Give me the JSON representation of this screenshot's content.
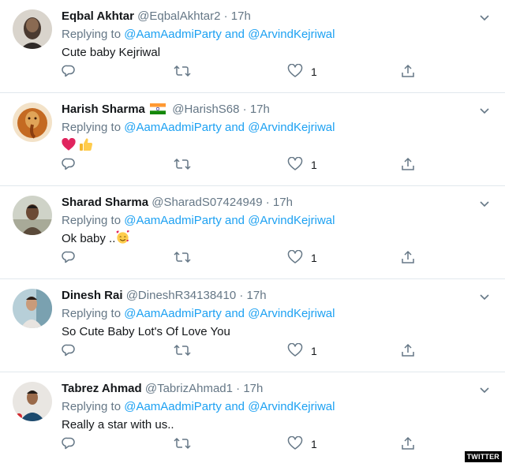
{
  "tweets": [
    {
      "name": "Eqbal Akhtar",
      "handle": "@EqbalAkhtar2",
      "dot": "·",
      "time": "17h",
      "replying_prefix": "Replying to",
      "mention1": "@AamAadmiParty",
      "and": "and",
      "mention2": "@ArvindKejriwal",
      "text": "Cute baby Kejriwal",
      "likes": "1"
    },
    {
      "name": "Harish Sharma",
      "handle": "@HarishS68",
      "dot": "·",
      "time": "17h",
      "replying_prefix": "Replying to",
      "mention1": "@AamAadmiParty",
      "and": "and",
      "mention2": "@ArvindKejriwal",
      "text": "",
      "likes": "1"
    },
    {
      "name": "Sharad Sharma",
      "handle": "@SharadS07424949",
      "dot": "·",
      "time": "17h",
      "replying_prefix": "Replying to",
      "mention1": "@AamAadmiParty",
      "and": "and",
      "mention2": "@ArvindKejriwal",
      "text": "Ok baby ..",
      "likes": "1"
    },
    {
      "name": "Dinesh Rai",
      "handle": "@DineshR34138410",
      "dot": "·",
      "time": "17h",
      "replying_prefix": "Replying to",
      "mention1": "@AamAadmiParty",
      "and": "and",
      "mention2": "@ArvindKejriwal",
      "text": "So Cute Baby Lot's Of Love You",
      "likes": "1"
    },
    {
      "name": "Tabrez Ahmad",
      "handle": "@TabrizAhmad1",
      "dot": "·",
      "time": "17h",
      "replying_prefix": "Replying to",
      "mention1": "@AamAadmiParty",
      "and": "and",
      "mention2": "@ArvindKejriwal",
      "text": "Really a star with us..",
      "likes": "1"
    }
  ],
  "icons": {
    "reply": "reply-icon",
    "retweet": "retweet-icon",
    "like": "heart-icon",
    "share": "share-icon",
    "caret": "chevron-down-icon"
  },
  "colors": {
    "mention": "#1da1f2",
    "secondary": "#657786",
    "divider": "#e1e8ed"
  },
  "watermark": "TWITTER"
}
